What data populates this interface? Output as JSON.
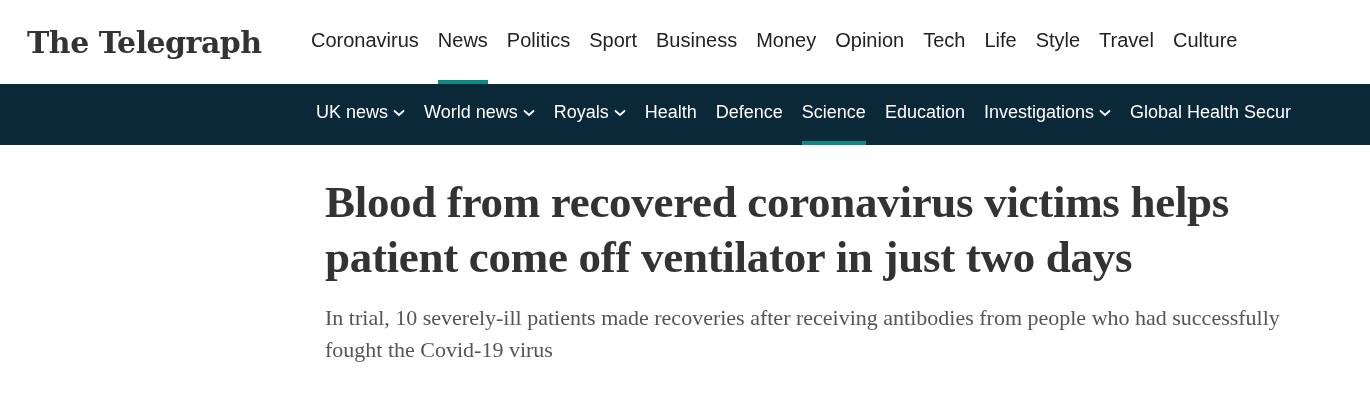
{
  "logo": "The Telegraph",
  "main_nav": [
    {
      "label": "Coronavirus",
      "selected": false
    },
    {
      "label": "News",
      "selected": true
    },
    {
      "label": "Politics",
      "selected": false
    },
    {
      "label": "Sport",
      "selected": false
    },
    {
      "label": "Business",
      "selected": false
    },
    {
      "label": "Money",
      "selected": false
    },
    {
      "label": "Opinion",
      "selected": false
    },
    {
      "label": "Tech",
      "selected": false
    },
    {
      "label": "Life",
      "selected": false
    },
    {
      "label": "Style",
      "selected": false
    },
    {
      "label": "Travel",
      "selected": false
    },
    {
      "label": "Culture",
      "selected": false
    }
  ],
  "sub_nav": [
    {
      "label": "UK news",
      "dropdown": true,
      "selected": false
    },
    {
      "label": "World news",
      "dropdown": true,
      "selected": false
    },
    {
      "label": "Royals",
      "dropdown": true,
      "selected": false
    },
    {
      "label": "Health",
      "dropdown": false,
      "selected": false
    },
    {
      "label": "Defence",
      "dropdown": false,
      "selected": false
    },
    {
      "label": "Science",
      "dropdown": false,
      "selected": true
    },
    {
      "label": "Education",
      "dropdown": false,
      "selected": false
    },
    {
      "label": "Investigations",
      "dropdown": true,
      "selected": false
    },
    {
      "label": "Global Health Secur",
      "dropdown": false,
      "selected": false
    }
  ],
  "article": {
    "headline": "Blood from recovered coronavirus victims helps patient come off ventilator in just two days",
    "standfirst": "In trial, 10 severely-ill patients made recoveries after receiving antibodies from people who had successfully fought the Covid-19 virus"
  }
}
